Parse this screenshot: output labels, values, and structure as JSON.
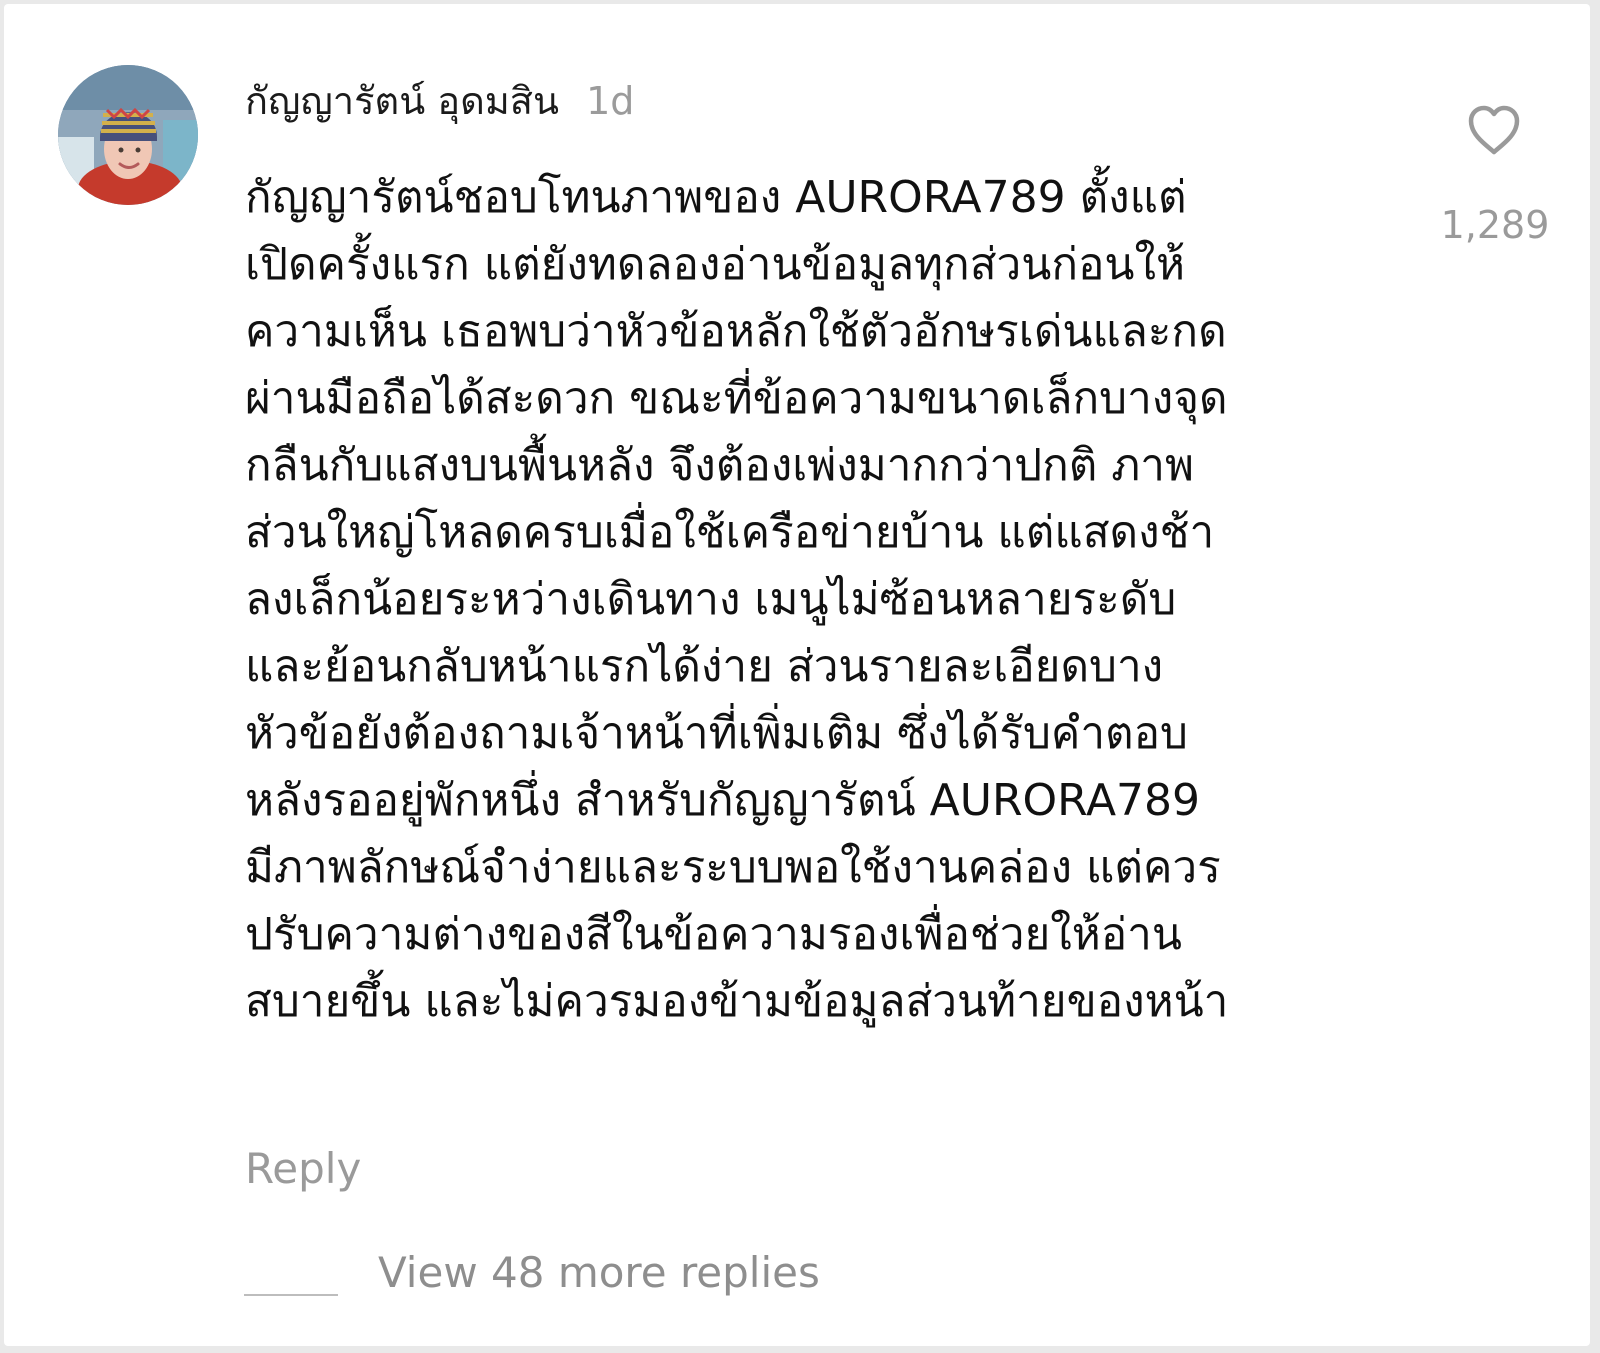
{
  "comment": {
    "username": "กัญญารัตน์ อุดมสิน",
    "timestamp": "1d",
    "text_lines": [
      "กัญญารัตน์ชอบโทนภาพของ AURORA789 ตั้งแต่",
      "เปิดครั้งแรก แต่ยังทดลองอ่านข้อมูลทุกส่วนก่อนให้",
      "ความเห็น เธอพบว่าหัวข้อหลักใช้ตัวอักษรเด่นและกด",
      "ผ่านมือถือได้สะดวก ขณะที่ข้อความขนาดเล็กบางจุด",
      "กลืนกับแสงบนพื้นหลัง จึงต้องเพ่งมากกว่าปกติ ภาพ",
      "ส่วนใหญ่โหลดครบเมื่อใช้เครือข่ายบ้าน แต่แสดงช้า",
      "ลงเล็กน้อยระหว่างเดินทาง เมนูไม่ซ้อนหลายระดับ",
      "และย้อนกลับหน้าแรกได้ง่าย ส่วนรายละเอียดบาง",
      "หัวข้อยังต้องถามเจ้าหน้าที่เพิ่มเติม ซึ่งได้รับคำตอบ",
      "หลังรออยู่พักหนึ่ง สำหรับกัญญารัตน์ AURORA789",
      "มีภาพลักษณ์จำง่ายและระบบพอใช้งานคล่อง แต่ควร",
      "ปรับความต่างของสีในข้อความรองเพื่อช่วยให้อ่าน",
      "สบายขึ้น และไม่ควรมองข้ามข้อมูลส่วนท้ายของหน้า"
    ],
    "likes": "1,289",
    "like_icon": "heart-outline-icon",
    "reply_label": "Reply",
    "view_replies_label": "View 48 more replies"
  },
  "colors": {
    "background": "#ffffff",
    "primary_text": "#111111",
    "secondary_text": "#9a9a9a"
  }
}
